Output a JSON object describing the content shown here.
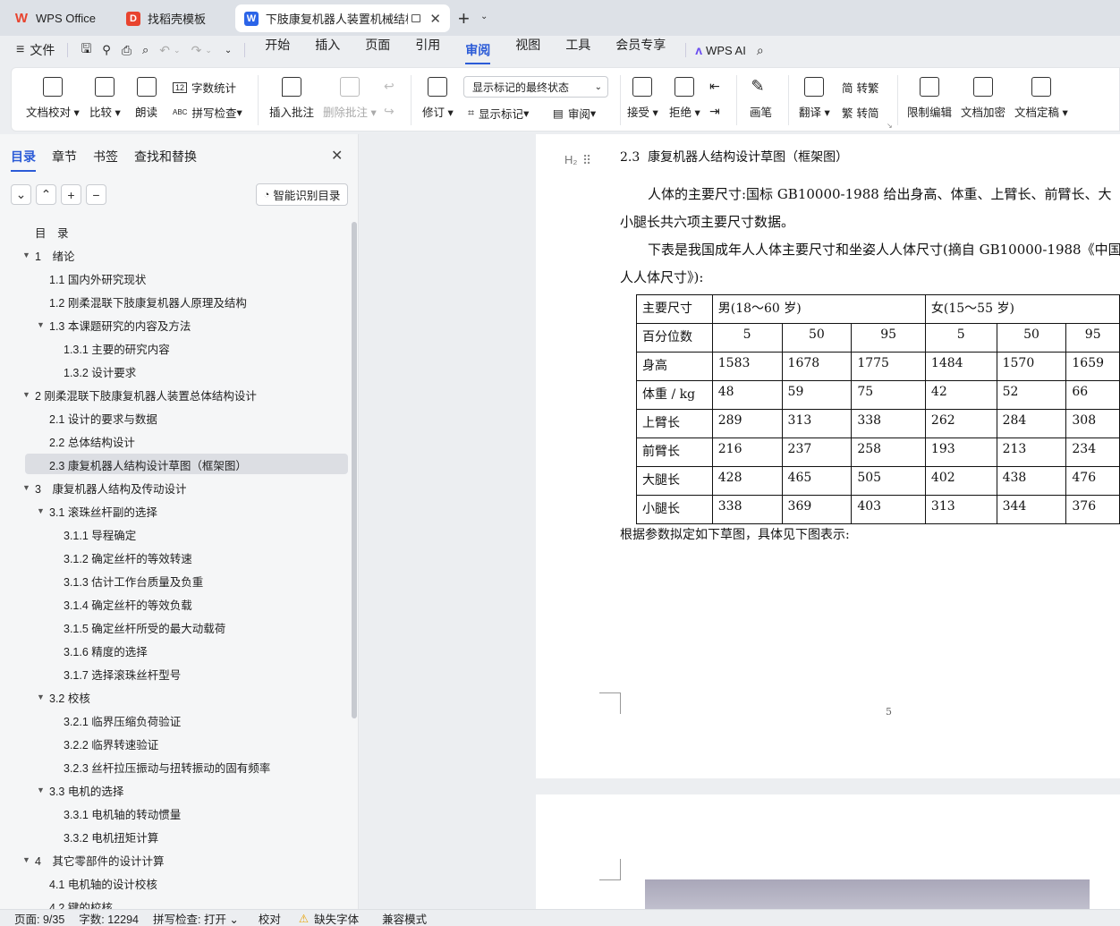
{
  "tabs": [
    {
      "label": "WPS Office",
      "color": "#e8432e",
      "glyph": "W",
      "icon": "wps-logo-icon"
    },
    {
      "label": "找稻壳模板",
      "color": "#e8432e",
      "glyph": "D",
      "icon": "docer-icon"
    },
    {
      "label": "下肢康复机器人装置机械结构",
      "color": "#2b64e8",
      "glyph": "W",
      "icon": "writer-doc-icon"
    }
  ],
  "menu": {
    "file": "文件",
    "items": [
      "开始",
      "插入",
      "页面",
      "引用",
      "审阅",
      "视图",
      "工具",
      "会员专享"
    ],
    "active": "审阅",
    "ai": "WPS AI"
  },
  "ribbon": {
    "doc_proof": "文档校对",
    "compare": "比较",
    "read": "朗读",
    "word_count": "字数统计",
    "spell_check": "拼写检查",
    "insert_comment": "插入批注",
    "delete_comment": "删除批注",
    "revise": "修订",
    "markup_state": "显示标记的最终状态",
    "show_markup": "显示标记",
    "review": "审阅",
    "accept": "接受",
    "reject": "拒绝",
    "pen": "画笔",
    "translate": "翻译",
    "to_traditional": "转繁",
    "to_simplified": "转简",
    "restrict_edit": "限制编辑",
    "encrypt": "文档加密",
    "finalize": "文档定稿"
  },
  "left_panel": {
    "tabs": [
      "目录",
      "章节",
      "书签",
      "查找和替换"
    ],
    "active_tab": "目录",
    "smart_toc": "智能识别目录"
  },
  "toc": [
    {
      "text": "目　录",
      "level": 0,
      "arrow": false
    },
    {
      "text": "1　绪论",
      "level": 1,
      "arrow": true
    },
    {
      "text": "1.1 国内外研究现状",
      "level": 2,
      "arrow": false
    },
    {
      "text": "1.2 刚柔混联下肢康复机器人原理及结构",
      "level": 2,
      "arrow": false
    },
    {
      "text": "1.3 本课题研究的内容及方法",
      "level": 2,
      "arrow": true
    },
    {
      "text": "1.3.1 主要的研究内容",
      "level": 3,
      "arrow": false
    },
    {
      "text": "1.3.2 设计要求",
      "level": 3,
      "arrow": false
    },
    {
      "text": "2 刚柔混联下肢康复机器人装置总体结构设计",
      "level": 1,
      "arrow": true
    },
    {
      "text": "2.1 设计的要求与数据",
      "level": 2,
      "arrow": false
    },
    {
      "text": "2.2 总体结构设计",
      "level": 2,
      "arrow": false
    },
    {
      "text": "2.3 康复机器人结构设计草图（框架图）",
      "level": 2,
      "arrow": false,
      "selected": true
    },
    {
      "text": "3　康复机器人结构及传动设计",
      "level": 1,
      "arrow": true
    },
    {
      "text": "3.1 滚珠丝杆副的选择",
      "level": 2,
      "arrow": true
    },
    {
      "text": "3.1.1 导程确定",
      "level": 3,
      "arrow": false
    },
    {
      "text": "3.1.2 确定丝杆的等效转速",
      "level": 3,
      "arrow": false
    },
    {
      "text": "3.1.3 估计工作台质量及负重",
      "level": 3,
      "arrow": false
    },
    {
      "text": "3.1.4 确定丝杆的等效负载",
      "level": 3,
      "arrow": false
    },
    {
      "text": "3.1.5 确定丝杆所受的最大动载荷",
      "level": 3,
      "arrow": false
    },
    {
      "text": "3.1.6 精度的选择",
      "level": 3,
      "arrow": false
    },
    {
      "text": "3.1.7 选择滚珠丝杆型号",
      "level": 3,
      "arrow": false
    },
    {
      "text": "3.2 校核",
      "level": 2,
      "arrow": true
    },
    {
      "text": "3.2.1 临界压缩负荷验证",
      "level": 3,
      "arrow": false
    },
    {
      "text": "3.2.2 临界转速验证",
      "level": 3,
      "arrow": false
    },
    {
      "text": "3.2.3 丝杆拉压振动与扭转振动的固有频率",
      "level": 3,
      "arrow": false
    },
    {
      "text": "3.3 电机的选择",
      "level": 2,
      "arrow": true
    },
    {
      "text": "3.3.1 电机轴的转动惯量",
      "level": 3,
      "arrow": false
    },
    {
      "text": "3.3.2 电机扭矩计算",
      "level": 3,
      "arrow": false
    },
    {
      "text": "4　其它零部件的设计计算",
      "level": 1,
      "arrow": true
    },
    {
      "text": "4.1 电机轴的设计校核",
      "level": 2,
      "arrow": false
    },
    {
      "text": "4.2 键的校核",
      "level": 2,
      "arrow": false
    }
  ],
  "document": {
    "heading_marker": "H₂",
    "heading": "2.3  康复机器人结构设计草图（框架图）",
    "para1_line1": "人体的主要尺寸:国标 GB10000-1988 给出身高、体重、上臂长、前臂长、大",
    "para1_line2": "小腿长共六项主要尺寸数据。",
    "para2_line1": "下表是我国成年人人体主要尺寸和坐姿人人体尺寸(摘自 GB10000-1988《中国",
    "para2_line2": "人人体尺寸》):",
    "table": {
      "header": [
        "主要尺寸",
        "男(18～60 岁)",
        "女(15～55 岁)"
      ],
      "percentile_label": "百分位数",
      "percentiles": [
        "5",
        "50",
        "95",
        "5",
        "50",
        "95"
      ],
      "rows": [
        {
          "name": "身高",
          "values": [
            "1583",
            "1678",
            "1775",
            "1484",
            "1570",
            "1659"
          ]
        },
        {
          "name": "体重 / kg",
          "values": [
            "48",
            "59",
            "75",
            "42",
            "52",
            "66"
          ]
        },
        {
          "name": "上臂长",
          "values": [
            "289",
            "313",
            "338",
            "262",
            "284",
            "308"
          ]
        },
        {
          "name": "前臂长",
          "values": [
            "216",
            "237",
            "258",
            "193",
            "213",
            "234"
          ]
        },
        {
          "name": "大腿长",
          "values": [
            "428",
            "465",
            "505",
            "402",
            "438",
            "476"
          ]
        },
        {
          "name": "小腿长",
          "values": [
            "338",
            "369",
            "403",
            "313",
            "344",
            "376"
          ]
        }
      ]
    },
    "after_table": "根据参数拟定如下草图，具体见下图表示:",
    "page_number": "5"
  },
  "status": {
    "page": "页面: 9/35",
    "words": "字数: 12294",
    "spell": "拼写检查: 打开",
    "proof": "校对",
    "missing_font": "缺失字体",
    "compat": "兼容模式"
  }
}
